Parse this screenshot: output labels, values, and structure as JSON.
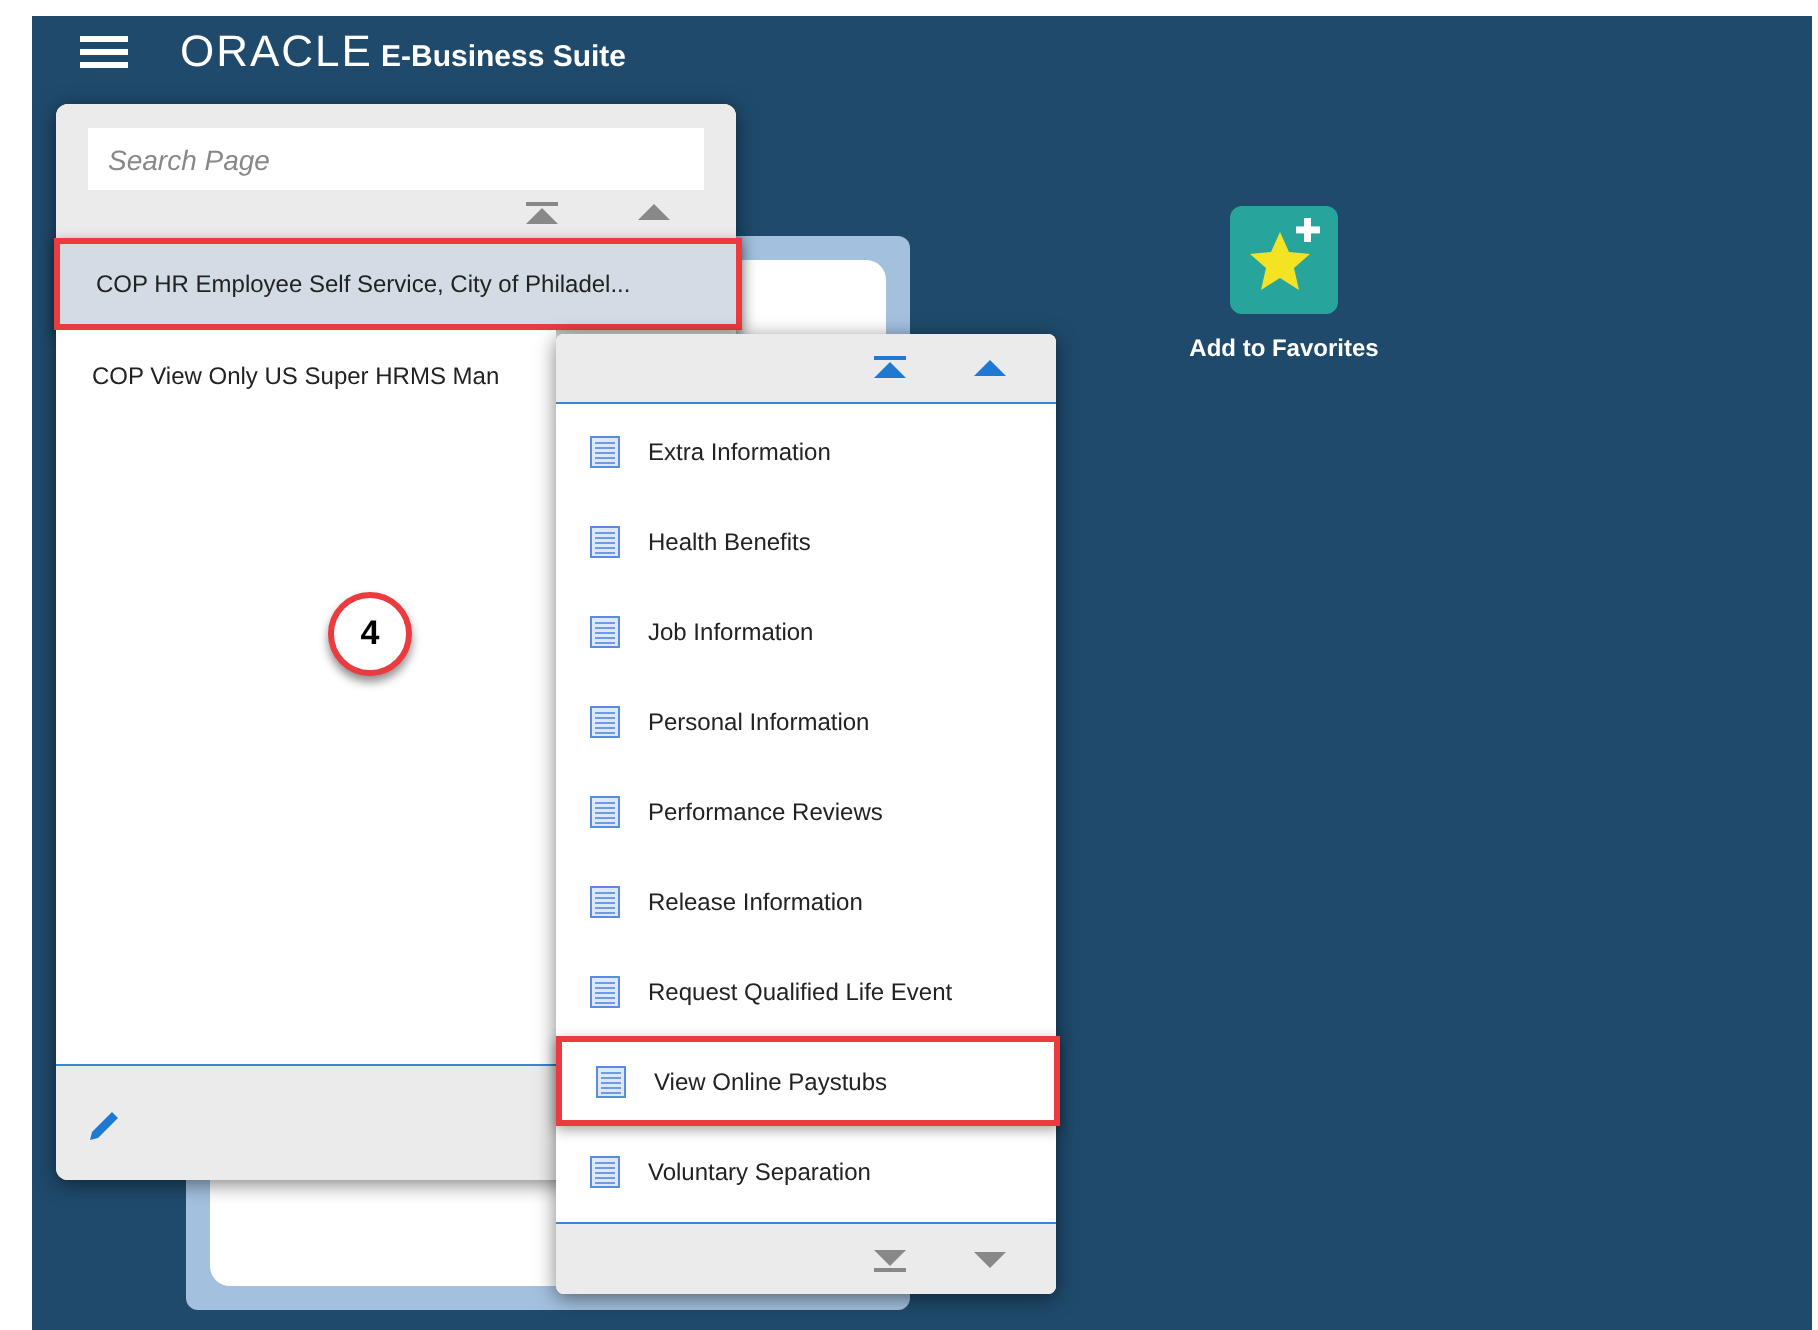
{
  "header": {
    "brand": "ORACLE",
    "product": "E-Business Suite"
  },
  "navigator": {
    "search": {
      "placeholder": "Search Page"
    },
    "responsibilities": [
      {
        "label": "COP HR Employee Self Service, City of Philadel...",
        "selected": true,
        "callout": true
      },
      {
        "label": "COP View Only US Super HRMS Man",
        "selected": false,
        "callout": false
      }
    ]
  },
  "step_badge": "4",
  "submenu": {
    "items": [
      {
        "label": "Extra Information",
        "callout": false
      },
      {
        "label": "Health Benefits",
        "callout": false
      },
      {
        "label": "Job Information",
        "callout": false
      },
      {
        "label": "Personal Information",
        "callout": false
      },
      {
        "label": "Performance Reviews",
        "callout": false
      },
      {
        "label": "Release Information",
        "callout": false
      },
      {
        "label": "Request Qualified Life Event",
        "callout": false
      },
      {
        "label": "View Online Paystubs",
        "callout": true
      },
      {
        "label": "Voluntary Separation",
        "callout": false
      }
    ]
  },
  "favorites": {
    "label": "Add to Favorites"
  }
}
